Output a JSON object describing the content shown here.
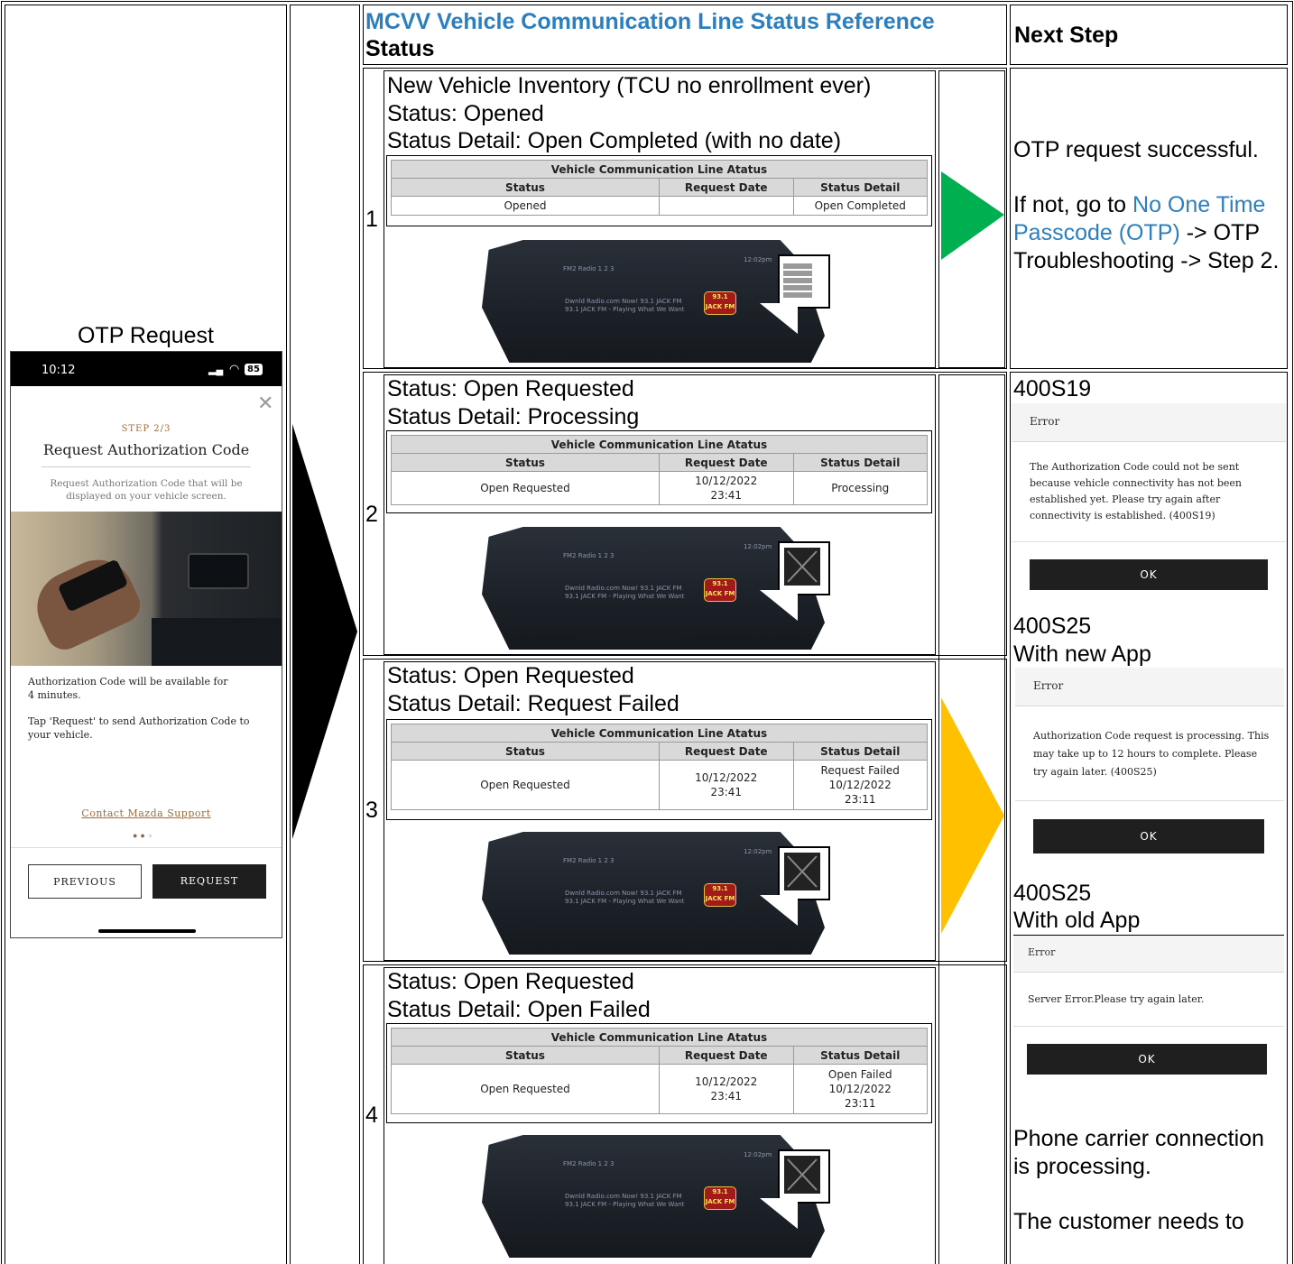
{
  "header": {
    "title": "MCVV Vehicle Communication Line Status Reference",
    "status_label": "Status",
    "next_step_label": "Next Step"
  },
  "left": {
    "otp_caption": "OTP Request"
  },
  "phone": {
    "time": "10:12",
    "battery": "85",
    "step": "STEP 2/3",
    "title": "Request Authorization Code",
    "subtitle": "Request Authorization Code that will be displayed on your vehicle screen.",
    "para1": "Authorization Code will be available for 4 minutes.",
    "para2": "Tap 'Request' to send Authorization Code to your vehicle.",
    "support_link": "Contact Mazda Support",
    "previous": "PREVIOUS",
    "request": "REQUEST"
  },
  "table_header": {
    "caption": "Vehicle Communication Line Atatus",
    "col_status": "Status",
    "col_request_date": "Request Date",
    "col_status_detail": "Status Detail"
  },
  "dashboard": {
    "clock": "12:02pm",
    "radio": "FM2  Radio  1 2 3",
    "line1": "Dwnld Radio.com Now!   93.1 JACK FM",
    "line2": "93.1 JACK FM - Playing What We Want",
    "logo_top": "93.1",
    "logo_bottom": "JACK FM"
  },
  "rows": [
    {
      "num": "1",
      "lines": [
        "New Vehicle Inventory (TCU no enrollment ever)",
        "Status: Opened",
        "Status Detail: Open Completed (with no date)"
      ],
      "table": {
        "status": "Opened",
        "date": "",
        "detail": "Open Completed"
      }
    },
    {
      "num": "2",
      "lines": [
        "Status: Open Requested",
        "Status Detail: Processing"
      ],
      "table": {
        "status": "Open Requested",
        "date": "10/12/2022 23:41",
        "detail": "Processing"
      }
    },
    {
      "num": "3",
      "lines": [
        "Status: Open Requested",
        "Status Detail: Request Failed"
      ],
      "table": {
        "status": "Open Requested",
        "date": "10/12/2022 23:41",
        "detail": "Request Failed 10/12/2022 23:11"
      }
    },
    {
      "num": "4",
      "lines": [
        "Status: Open Requested",
        "Status Detail: Open Failed"
      ],
      "table": {
        "status": "Open Requested",
        "date": "10/12/2022 23:41",
        "detail": "Open Failed 10/12/2022 23:11"
      }
    }
  ],
  "next_step": {
    "row1_line1": "OTP request successful.",
    "row1_if_not": "If not, go to ",
    "row1_link": "No One Time Passcode (OTP)",
    "row1_rest": " -> OTP Troubleshooting -> Step 2.",
    "code_a": "400S19",
    "code_b": "400S25",
    "code_b_app": "With new App",
    "code_c": "400S25",
    "code_c_app": "With old App",
    "carrier_1": "Phone carrier connection is processing.",
    "carrier_2": "The customer needs to"
  },
  "dialogs": {
    "error_title": "Error",
    "ok": "OK",
    "msg_400S19": "The Authorization Code could not be sent because vehicle connectivity has not been established yet. Please try again after connectivity is established. (400S19)",
    "msg_400S25": "Authorization Code request is processing. This may take up to 12 hours to complete. Please try again later. (400S25)",
    "msg_old": "Server Error.Please try again later."
  },
  "colors": {
    "link": "#2b7fc0",
    "arrow_green": "#00b050",
    "arrow_yellow": "#ffc000",
    "arrow_black": "#000000"
  }
}
